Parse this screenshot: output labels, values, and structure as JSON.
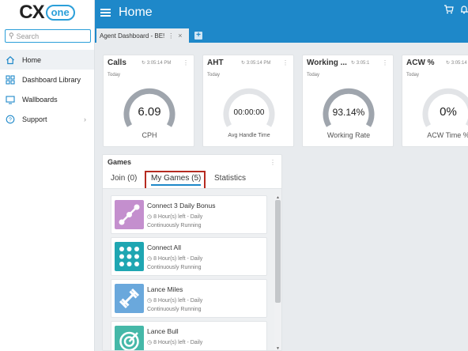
{
  "app": {
    "logo_main": "CX",
    "logo_sub": "one",
    "page_title": "Home"
  },
  "search": {
    "placeholder": "Search"
  },
  "nav": {
    "items": [
      {
        "label": "Home",
        "icon": "home-icon"
      },
      {
        "label": "Dashboard Library",
        "icon": "dashboard-icon"
      },
      {
        "label": "Wallboards",
        "icon": "monitor-icon"
      },
      {
        "label": "Support",
        "icon": "help-icon"
      }
    ]
  },
  "tabs": {
    "active_label": "Agent Dashboard - BE!",
    "more": "⋮",
    "close": "×",
    "add": "+"
  },
  "widgets": [
    {
      "title": "Calls",
      "time": "3:05:14 PM",
      "sub": "Today",
      "value": "6.09",
      "label": "CPH"
    },
    {
      "title": "AHT",
      "time": "3:05:14 PM",
      "sub": "Today",
      "value": "00:00:00",
      "label": "Avg Handle Time"
    },
    {
      "title": "Working ...",
      "time": "3:05:1",
      "sub": "Today",
      "value": "93.14%",
      "label": "Working Rate"
    },
    {
      "title": "ACW %",
      "time": "3:05:14",
      "sub": "Today",
      "value": "0%",
      "label": "ACW Time %"
    }
  ],
  "games": {
    "title": "Games",
    "tabs": [
      "Join (0)",
      "My Games (5)",
      "Statistics"
    ],
    "active_tab": "My Games (5)",
    "items": [
      {
        "name": "Connect 3 Daily Bonus",
        "time": "8 Hour(s) left - Daily",
        "status": "Continuously Running",
        "icon": "connect-dots-icon",
        "color": "#c48fce"
      },
      {
        "name": "Connect All",
        "time": "8 Hour(s) left - Daily",
        "status": "Continuously Running",
        "icon": "grid-dots-icon",
        "color": "#1fa6b2"
      },
      {
        "name": "Lance Miles",
        "time": "8 Hour(s) left - Daily",
        "status": "Continuously Running",
        "icon": "dumbbell-icon",
        "color": "#6aa8dc"
      },
      {
        "name": "Lance Bull",
        "time": "8 Hour(s) left - Daily",
        "status": "",
        "icon": "target-icon",
        "color": "#45b8a8"
      }
    ]
  },
  "colors": {
    "topbar": "#1e88c9",
    "gauge_track": "#9fa5ad",
    "highlight": "#b52a20"
  }
}
